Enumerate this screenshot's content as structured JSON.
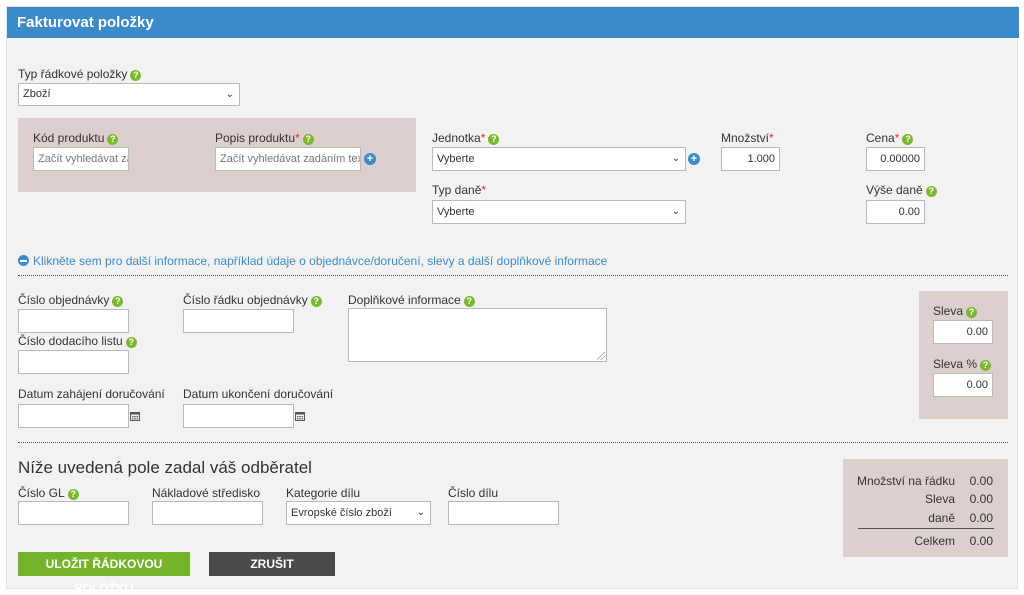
{
  "header": {
    "title": "Fakturovat položky"
  },
  "line_item_type": {
    "label": "Typ řádkové položky",
    "value": "Zboží"
  },
  "product": {
    "code_label": "Kód produktu",
    "code_placeholder": "Začít vyhledávat za",
    "desc_label": "Popis produktu",
    "desc_placeholder": "Začít vyhledávat zadáním textu",
    "required_mark": "*"
  },
  "unit": {
    "label": "Jednotka",
    "value": "Vyberte"
  },
  "quantity": {
    "label": "Množství",
    "value": "1.000"
  },
  "price": {
    "label": "Cena",
    "value": "0.00000"
  },
  "tax_type": {
    "label": "Typ daně",
    "value": "Vyberte"
  },
  "tax_amount": {
    "label": "Výše daně",
    "value": "0.00"
  },
  "more_info_link": "Klikněte sem pro další informace, například údaje o objednávce/doručení, slevy a další doplňkové informace",
  "order": {
    "order_number_label": "Číslo objednávky",
    "order_line_label": "Číslo řádku objednávky",
    "additional_info_label": "Doplňkové informace",
    "delivery_note_label": "Číslo dodacího listu",
    "delivery_start_label": "Datum zahájení doručování",
    "delivery_end_label": "Datum ukončení doručování"
  },
  "discount": {
    "discount_label": "Sleva",
    "discount_value": "0.00",
    "discount_pct_label": "Sleva %",
    "discount_pct_value": "0.00"
  },
  "buyer": {
    "title": "Níže uvedená pole zadal váš odběratel",
    "gl_label": "Číslo GL",
    "cost_center_label": "Nákladové středisko",
    "category_label": "Kategorie dílu",
    "category_value": "Evropské číslo zboží",
    "part_number_label": "Číslo dílu"
  },
  "summary": {
    "rows": [
      {
        "label": "Množství na řádku",
        "value": "0.00"
      },
      {
        "label": "Sleva",
        "value": "0.00"
      },
      {
        "label": "daně",
        "value": "0.00"
      }
    ],
    "total_label": "Celkem",
    "total_value": "0.00"
  },
  "buttons": {
    "save": "ULOŽIT ŘÁDKOVOU POLOŽKU",
    "cancel": "ZRUŠIT"
  },
  "colors": {
    "header": "#3c8bc8",
    "help": "#7cb82f",
    "save": "#75b42a",
    "cancel": "#4a4a4a",
    "box": "#dcd0ce",
    "required": "#d9302c"
  }
}
